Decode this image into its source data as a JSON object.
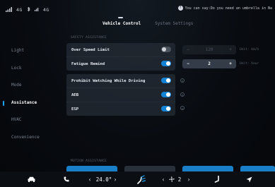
{
  "status_bar": {
    "signal": "4G",
    "net2": "4G",
    "notification": "You can say:Do you need an umbrella in Na"
  },
  "tabs": [
    {
      "label": "Vehicle Control",
      "active": true
    },
    {
      "label": "System Settings",
      "active": false
    }
  ],
  "sidebar": {
    "items": [
      {
        "label": "Light"
      },
      {
        "label": "Lock"
      },
      {
        "label": "Mode"
      },
      {
        "label": "Assistance"
      },
      {
        "label": "HVAC"
      },
      {
        "label": "Convenience"
      }
    ],
    "active_index": 3
  },
  "sections": {
    "safety_assistance": "SAFETY ASSISTANCE",
    "motion_assistance": "MOTION ASSISTANCE"
  },
  "settings": {
    "group1": [
      {
        "label": "Over Speed Limit",
        "on": false
      },
      {
        "label": "Fatigue Remind",
        "on": true
      }
    ],
    "group2": [
      {
        "label": "Prohibit Watching While Driving",
        "on": true
      },
      {
        "label": "AEB",
        "on": true
      },
      {
        "label": "ESP",
        "on": true
      }
    ]
  },
  "steppers": {
    "over_speed": {
      "minus": "−",
      "value": "120",
      "plus": "+",
      "unit": "Unit: km/h"
    },
    "fatigue": {
      "minus": "−",
      "value": "2",
      "plus": "+",
      "unit": "Unit: hour"
    }
  },
  "dock": {
    "left_temp": "24.0°",
    "fan_level": "2",
    "left_arrow": "‹",
    "right_arrow": "›"
  },
  "colors": {
    "accent": "#1483d6",
    "background": "#06080c",
    "panel": "#262c36"
  }
}
